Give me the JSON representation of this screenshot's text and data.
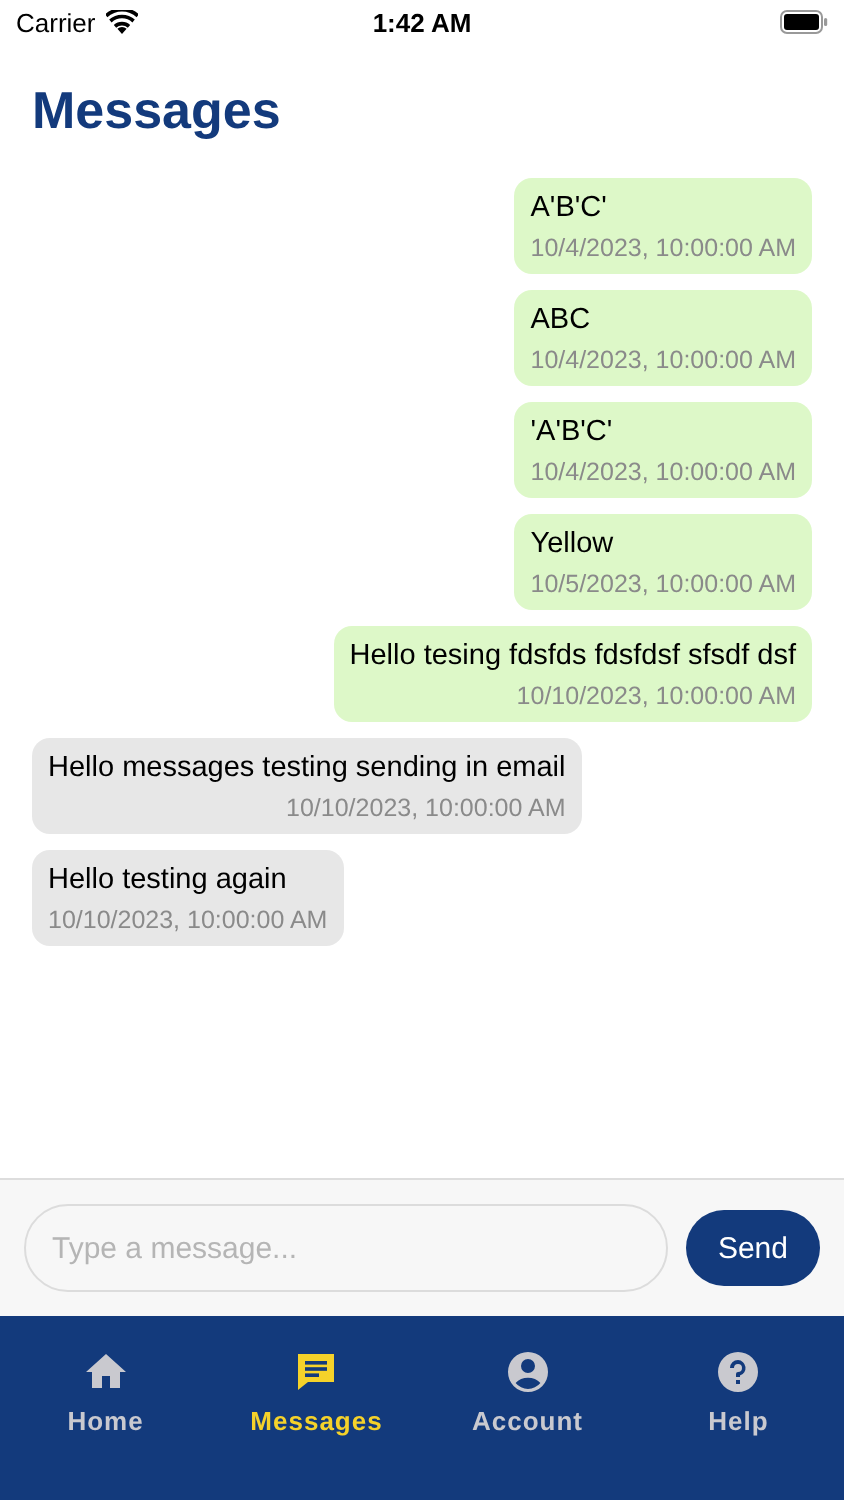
{
  "status_bar": {
    "carrier": "Carrier",
    "time": "1:42 AM"
  },
  "title": "Messages",
  "messages": [
    {
      "kind": "sent",
      "text": "A'B'C'",
      "time": "10/4/2023, 10:00:00 AM"
    },
    {
      "kind": "sent",
      "text": "ABC",
      "time": "10/4/2023, 10:00:00 AM"
    },
    {
      "kind": "sent",
      "text": "'A'B'C'",
      "time": "10/4/2023, 10:00:00 AM"
    },
    {
      "kind": "sent",
      "text": "Yellow",
      "time": "10/5/2023, 10:00:00 AM"
    },
    {
      "kind": "sent",
      "text": "Hello tesing fdsfds fdsfdsf sfsdf dsf",
      "time": "10/10/2023, 10:00:00 AM"
    },
    {
      "kind": "received",
      "text": "Hello messages testing sending in email",
      "time": "10/10/2023, 10:00:00 AM"
    },
    {
      "kind": "received",
      "text": "Hello testing again",
      "time": "10/10/2023, 10:00:00 AM"
    }
  ],
  "composer": {
    "placeholder": "Type a message...",
    "send_label": "Send"
  },
  "tabs": [
    {
      "label": "Home",
      "selected": false
    },
    {
      "label": "Messages",
      "selected": true
    },
    {
      "label": "Account",
      "selected": false
    },
    {
      "label": "Help",
      "selected": false
    }
  ]
}
